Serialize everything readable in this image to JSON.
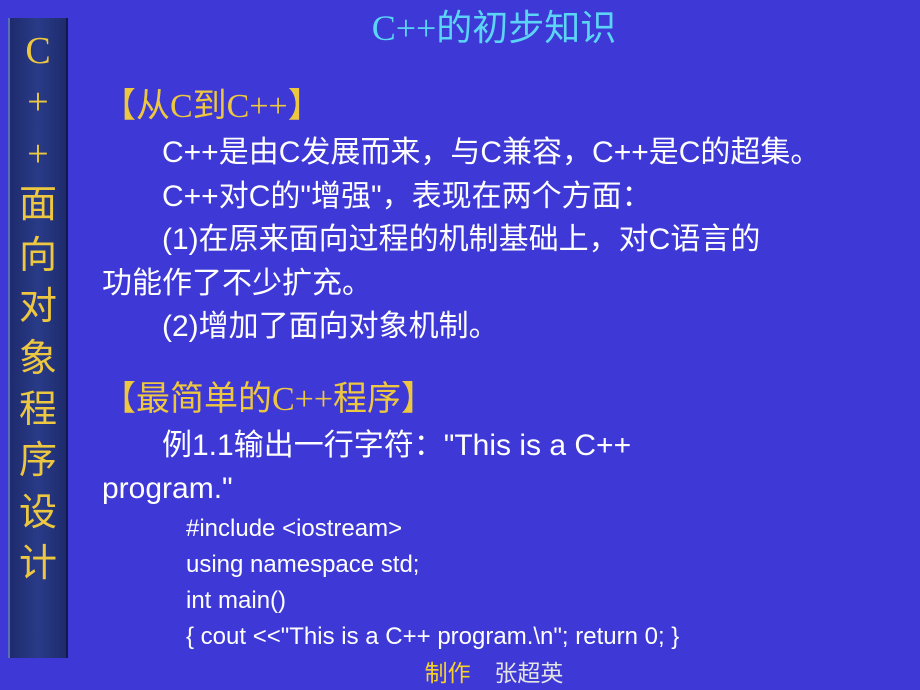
{
  "sidebar_chars": [
    "C",
    "+",
    "+",
    "面",
    "向",
    "对",
    "象",
    "程",
    "序",
    "设",
    "计"
  ],
  "title": "C++的初步知识",
  "section1": {
    "header": "【从C到C++】",
    "line1": "C++是由C发展而来，与C兼容，C++是C的超集。",
    "line2": "C++对C的\"增强\"，表现在两个方面：",
    "line3": "(1)在原来面向过程的机制基础上，对C语言的",
    "line3b": "功能作了不少扩充。",
    "line4": "(2)增加了面向对象机制。"
  },
  "section2": {
    "header": "【最简单的C++程序】",
    "line1a": "例1.1输出一行字符：\"This is a C++",
    "line1b": "program.\"",
    "code1": "#include <iostream>",
    "code2": "using namespace std;",
    "code3": "int main()",
    "code4": "{ cout <<\"This is a C++ program.\\n\";  return 0; }"
  },
  "footer": {
    "label": "制作",
    "name": "张超英"
  }
}
